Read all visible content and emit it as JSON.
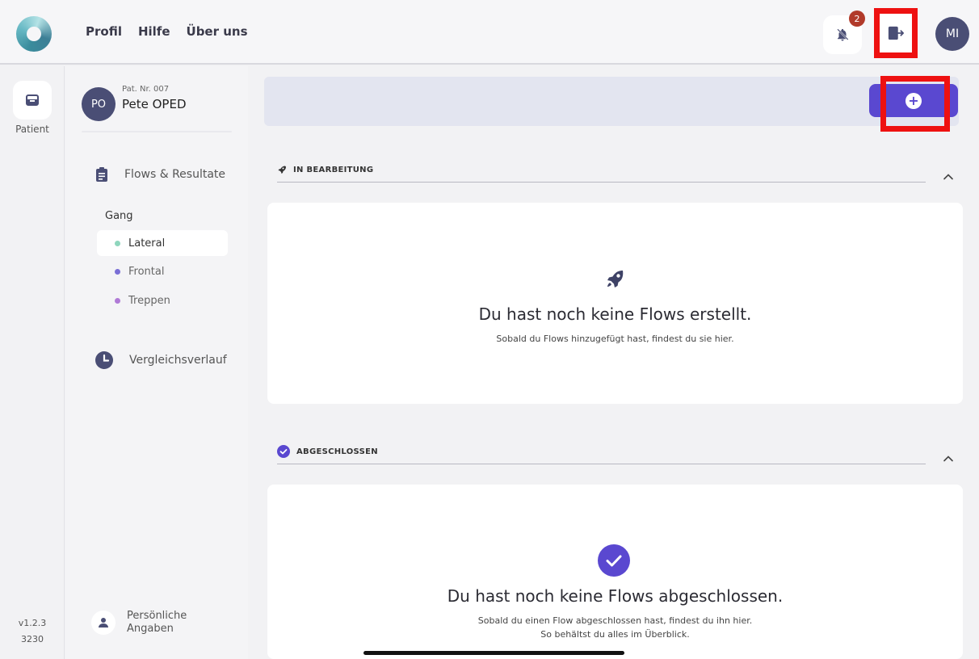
{
  "topbar": {
    "nav": [
      "Profil",
      "Hilfe",
      "Über uns"
    ],
    "notification_count": "2",
    "user_initials": "MI"
  },
  "rail": {
    "patient_label": "Patient",
    "version": "v1.2.3",
    "build": "3230"
  },
  "patient": {
    "initials": "PO",
    "number": "Pat. Nr. 007",
    "name": "Pete OPED"
  },
  "sidebar": {
    "flows_label": "Flows & Resultate",
    "group_label": "Gang",
    "sub_items": [
      {
        "label": "Lateral",
        "color": "#8fd6bd"
      },
      {
        "label": "Frontal",
        "color": "#7a6fd6"
      },
      {
        "label": "Treppen",
        "color": "#b07ad6"
      }
    ],
    "history_label": "Vergleichsverlauf",
    "personal_label_1": "Persönliche",
    "personal_label_2": "Angaben"
  },
  "sections": {
    "in_progress": {
      "header": "IN BEARBEITUNG",
      "title": "Du hast noch keine Flows erstellt.",
      "subtitle": "Sobald du Flows hinzugefügt hast, findest du sie hier."
    },
    "completed": {
      "header": "ABGESCHLOSSEN",
      "title": "Du hast noch keine Flows abgeschlossen.",
      "subtitle_1": "Sobald du einen Flow abgeschlossen hast, findest du ihn hier.",
      "subtitle_2": "So behältst du alles im Überblick."
    }
  },
  "colors": {
    "accent": "#5a48d0",
    "highlight": "#ee1111",
    "avatar": "#4a4e75"
  },
  "icons": [
    "logo-icon",
    "bell-off-icon",
    "logout-icon",
    "inbox-icon",
    "clipboard-icon",
    "clock-icon",
    "person-icon",
    "rocket-icon",
    "check-circle-icon",
    "plus-icon",
    "chevron-up-icon"
  ]
}
